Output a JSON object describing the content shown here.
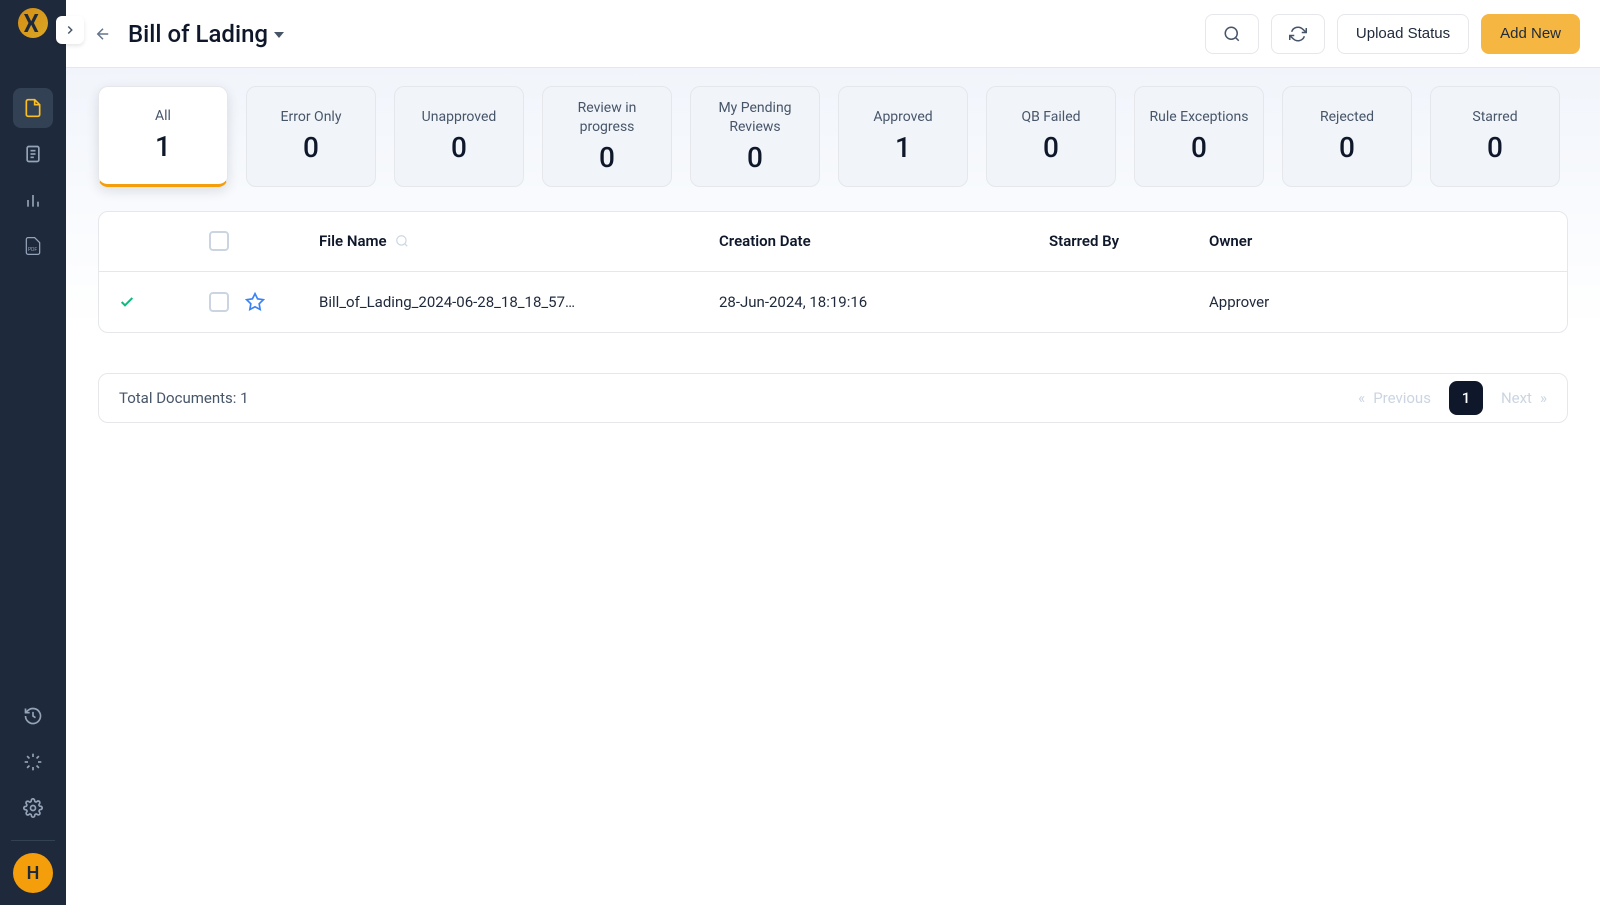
{
  "page_title": "Bill of Lading",
  "topbar": {
    "upload_status_label": "Upload Status",
    "add_new_label": "Add New"
  },
  "avatar_letter": "H",
  "filters": [
    {
      "label": "All",
      "count": "1",
      "active": true
    },
    {
      "label": "Error Only",
      "count": "0",
      "active": false
    },
    {
      "label": "Unapproved",
      "count": "0",
      "active": false
    },
    {
      "label": "Review in progress",
      "count": "0",
      "active": false
    },
    {
      "label": "My Pending Reviews",
      "count": "0",
      "active": false
    },
    {
      "label": "Approved",
      "count": "1",
      "active": false
    },
    {
      "label": "QB Failed",
      "count": "0",
      "active": false
    },
    {
      "label": "Rule Exceptions",
      "count": "0",
      "active": false
    },
    {
      "label": "Rejected",
      "count": "0",
      "active": false
    },
    {
      "label": "Starred",
      "count": "0",
      "active": false
    }
  ],
  "table": {
    "columns": {
      "file_name": "File Name",
      "creation_date": "Creation Date",
      "starred_by": "Starred By",
      "owner": "Owner"
    },
    "rows": [
      {
        "status": "approved",
        "file_name": "Bill_of_Lading_2024-06-28_18_18_57…",
        "creation_date": "28-Jun-2024, 18:19:16",
        "starred_by": "",
        "owner": "Approver"
      }
    ]
  },
  "footer": {
    "total_label": "Total Documents: 1",
    "prev_label": "Previous",
    "next_label": "Next",
    "current_page": "1"
  }
}
